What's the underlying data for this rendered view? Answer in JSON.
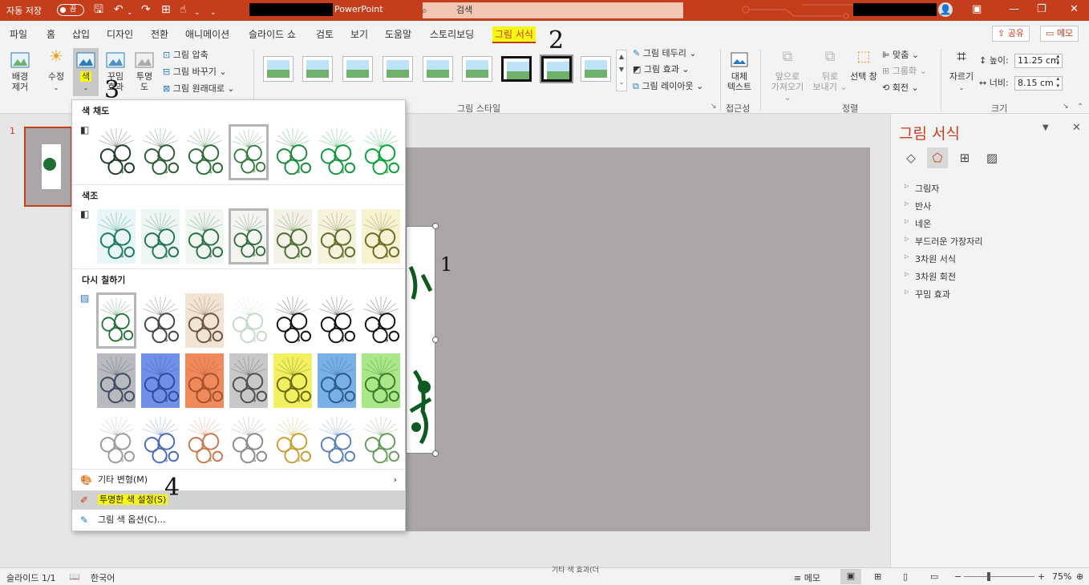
{
  "titlebar": {
    "autosave_label": "자동 저장",
    "autosave_state": "끔",
    "app_name": "PowerPoint",
    "search_placeholder": "검색",
    "icons": [
      "save-icon",
      "undo-icon",
      "redo-icon",
      "present-icon",
      "touch-mode-icon",
      "customize-icon",
      "minimize-icon",
      "restore-icon",
      "close-icon"
    ]
  },
  "tabs": [
    "파일",
    "홈",
    "삽입",
    "디자인",
    "전환",
    "애니메이션",
    "슬라이드 쇼",
    "검토",
    "보기",
    "도움말",
    "스토리보딩",
    "그림 서식"
  ],
  "header_buttons": {
    "share": "공유",
    "comment": "메모"
  },
  "ribbon": {
    "remove_bg": [
      "배경",
      "제거"
    ],
    "corrections": "수정",
    "color": "색",
    "artistic": [
      "꾸밈",
      "효과"
    ],
    "transparency": [
      "투명",
      "도"
    ],
    "compress": "그림 압축",
    "change": "그림 바꾸기",
    "reset": "그림 원래대로",
    "group_styles": "그림 스타일",
    "border": "그림 테두리",
    "effects": "그림 효과",
    "layout": "그림 레이아웃",
    "alt_text": [
      "대체",
      "텍스트"
    ],
    "group_access": "접근성",
    "bring_forward": [
      "앞으로",
      "가져오기"
    ],
    "send_backward": [
      "뒤로",
      "보내기"
    ],
    "selection_pane": "선택 창",
    "align": "맞춤",
    "group": "그룹화",
    "rotate": "회전",
    "group_arrange": "정렬",
    "crop": "자르기",
    "height_label": "높이:",
    "height_value": "11.25 cm",
    "width_label": "너비:",
    "width_value": "8.15 cm",
    "group_size": "크기"
  },
  "slide_number": "1",
  "dropdown": {
    "sec_saturation": "색 채도",
    "sec_tone": "색조",
    "sec_recolor": "다시 칠하기",
    "more_variations": "기타 변형(M)",
    "set_transparent": "투명한 색 설정(S)",
    "color_options": "그림 색 옵션(C)..."
  },
  "format_panel": {
    "title": "그림 서식",
    "items": [
      "그림자",
      "반사",
      "네온",
      "부드러운 가장자리",
      "3차원 서식",
      "3차원 회전",
      "꾸밈 효과"
    ]
  },
  "status": {
    "slide": "슬라이드 1/1",
    "language": "한국어",
    "notes": "메모",
    "zoom": "75%",
    "partial_text": "기타 색 효과(더"
  },
  "annotations": [
    "1",
    "2",
    "3",
    "4"
  ],
  "colors": {
    "accent": "#c43e1c",
    "highlight": "#f7f716"
  },
  "thumb_rows": {
    "saturation": [
      "#1f3a25",
      "#2e5a35",
      "#2b6a36",
      "#2e7a3a",
      "#1c8a3c",
      "#12963a",
      "#08a038"
    ],
    "tone": [
      "#1f7a5e",
      "#237558",
      "#2a7048",
      "#2e6b3b",
      "#4b6e36",
      "#5d6e30",
      "#6a6c2b"
    ],
    "recolor1": [
      "#1f6e34",
      "#444444",
      "#6a5540",
      "#c6d8c8",
      "#111111",
      "#111111",
      "#111111"
    ],
    "recolor2": [
      "#3e4a5e",
      "#2e4a9a",
      "#a4502a",
      "#4e4e4e",
      "#6a6a10",
      "#2a5a8a",
      "#3a7a2a"
    ],
    "recolor3": [
      "#9a9a9a",
      "#4a6ab0",
      "#c87850",
      "#8a8a8a",
      "#c8a030",
      "#5a80b0",
      "#6a9a5a"
    ],
    "recolor2_bg": [
      "#b8bac0",
      "#7090e8",
      "#f08a5a",
      "#c8c8c8",
      "#f0f060",
      "#7ab0e8",
      "#a8e888"
    ]
  }
}
